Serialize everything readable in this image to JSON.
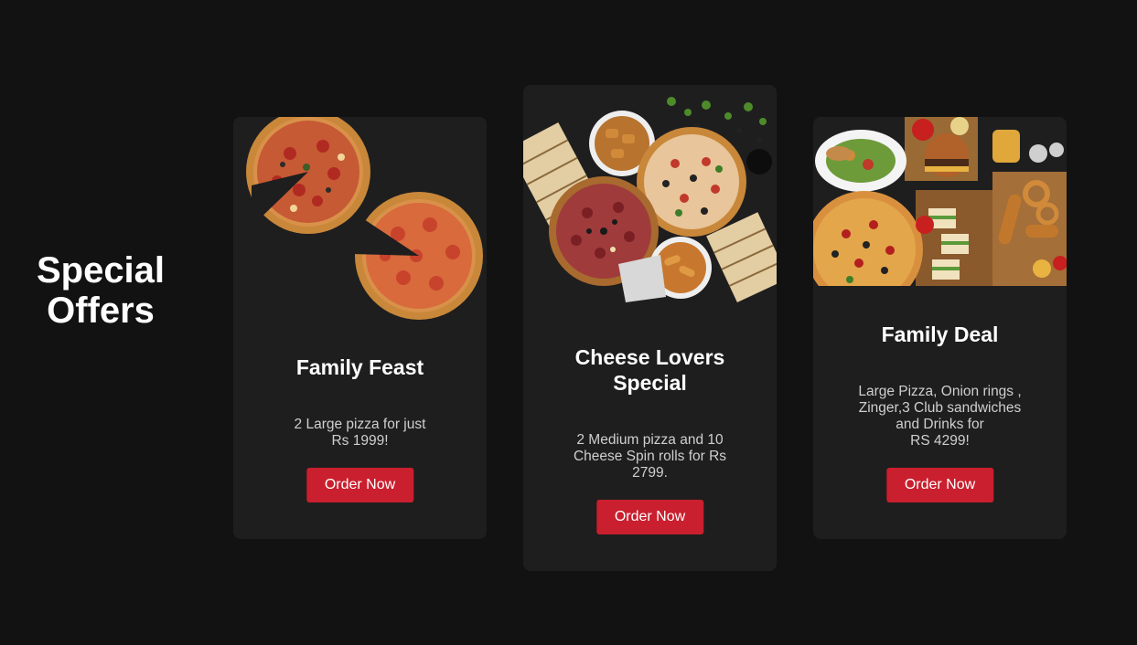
{
  "section": {
    "title": "Special\nOffers"
  },
  "offers": [
    {
      "title": "Family Feast",
      "description": "2 Large pizza for just\nRs 1999!",
      "button_label": "Order Now"
    },
    {
      "title": "Cheese Lovers\nSpecial",
      "description": "2 Medium pizza and 10\nCheese Spin rolls for Rs\n2799.",
      "button_label": "Order Now"
    },
    {
      "title": "Family Deal",
      "description": "Large Pizza, Onion rings ,\nZinger,3 Club sandwiches\nand Drinks for\nRS 4299!",
      "button_label": "Order Now"
    }
  ],
  "colors": {
    "background": "#121212",
    "card": "#1e1e1f",
    "accent": "#ca1f2e",
    "title_text": "#ffffff",
    "body_text": "#cfcfcf"
  },
  "icons": {
    "card_1_image": "two-pizzas-image",
    "card_2_image": "pizza-spread-image",
    "card_3_image": "burger-pizza-spread-image"
  }
}
